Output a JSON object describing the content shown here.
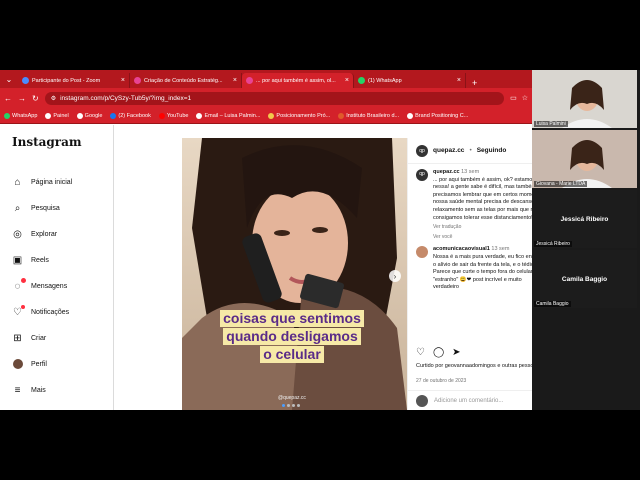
{
  "browser": {
    "tabs": [
      {
        "title": "Participante do Post - Zoom",
        "fav": "#4a8cff",
        "active": false
      },
      {
        "title": "Criação de Conteúdo Estratég...",
        "fav": "#e84393",
        "active": false
      },
      {
        "title": "... por aqui também é assim, ol...",
        "fav": "#e84393",
        "active": true
      },
      {
        "title": "(1) WhatsApp",
        "fav": "#25d366",
        "active": false
      }
    ],
    "url": "instagram.com/p/CySzy-Tub5y/?img_index=1",
    "bookmarks": [
      {
        "label": "WhatsApp",
        "color": "#25d366"
      },
      {
        "label": "Painel",
        "color": "#ffffff"
      },
      {
        "label": "Google",
        "color": "#ffffff"
      },
      {
        "label": "(2) Facebook",
        "color": "#1877f2"
      },
      {
        "label": "YouTube",
        "color": "#ff0000"
      },
      {
        "label": "Email – Luisa Palmin...",
        "color": "#ffffff"
      },
      {
        "label": "Posicionamento Pró...",
        "color": "#f2c94c"
      },
      {
        "label": "Instituto Brasileiro d...",
        "color": "#e05a2b"
      },
      {
        "label": "Brand Positioning C...",
        "color": "#ffffff"
      }
    ]
  },
  "instagram": {
    "logo": "Instagram",
    "nav": [
      {
        "label": "Página inicial",
        "icon": "home-icon",
        "glyph": "⌂"
      },
      {
        "label": "Pesquisa",
        "icon": "search-icon",
        "glyph": "⌕"
      },
      {
        "label": "Explorar",
        "icon": "compass-icon",
        "glyph": "◎"
      },
      {
        "label": "Reels",
        "icon": "reels-icon",
        "glyph": "▣"
      },
      {
        "label": "Mensagens",
        "icon": "messenger-icon",
        "glyph": "◌"
      },
      {
        "label": "Notificações",
        "icon": "heart-icon",
        "glyph": "♡"
      },
      {
        "label": "Criar",
        "icon": "create-icon",
        "glyph": "⊞"
      },
      {
        "label": "Perfil",
        "icon": "avatar",
        "glyph": ""
      },
      {
        "label": "Mais",
        "icon": "menu-icon",
        "glyph": "≡"
      }
    ],
    "post": {
      "caption_lines": [
        "coisas que sentimos",
        "quando desligamos",
        "o celular"
      ],
      "watermark": "@quepaz.cc",
      "account": "quepaz.cc",
      "follow_state": "Seguindo",
      "comment_author": "quepaz.cc",
      "comment_time": "13 sem",
      "comment_text": "... por aqui também é assim, ok? estamos juntas nessa! a gente sabe é difícil, mas também precisamos lembrar que em certos momentos... nossa saúde mental precisa de descanso e relaxamento sem as telas por mais que não consigamos tolerar esse distanciamento! ❤",
      "see_translation": "Ver tradução",
      "more": "Ver você",
      "reply_author": "acomunicacaovisual1",
      "reply_time": "13 sem",
      "reply_text": "Nossa é a mais pura verdade, eu fico entre o alívio de sair da frente da tela, e o tédio! Parece que curte o tempo fora do celular é \"estranho\" 😩❤ post incrível e muito verdadeiro",
      "liked_by": "Curtido por geovannaadomingos e outras pessoas",
      "date": "27 de outubro de 2023",
      "add_comment": "Adicione um comentário..."
    }
  },
  "zoom": {
    "participants": [
      {
        "name": "Luisa Palmini",
        "video": true,
        "bg": "#d9d6d0"
      },
      {
        "name": "Giovana - Marie LTDA",
        "video": true,
        "bg": "#c9b8ad"
      },
      {
        "name": "Jessicá Ribeiro",
        "video": false,
        "bg": "#1c1c1c"
      },
      {
        "name": "Camila Baggio",
        "video": false,
        "bg": "#1c1c1c"
      }
    ]
  }
}
